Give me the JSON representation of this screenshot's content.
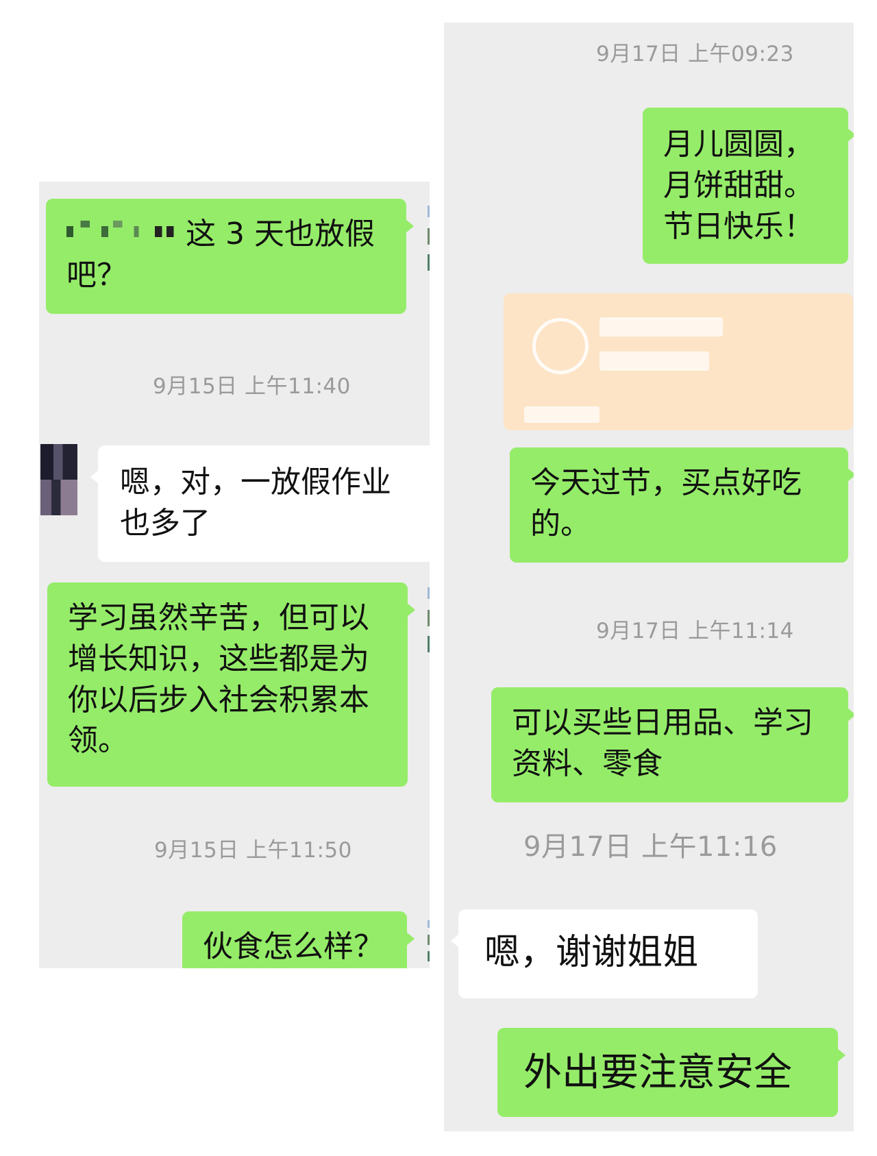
{
  "left": {
    "msg1_text": "这 3 天也放假吧？",
    "ts1": "9月15日 上午11:40",
    "msg2_text": "嗯，对，一放假作业也多了",
    "msg3_text": "学习虽然辛苦，但可以增长知识，这些都是为你以后步入社会积累本领。",
    "ts2": "9月15日 上午11:50",
    "msg4_text": "伙食怎么样？"
  },
  "right": {
    "ts1": "9月17日 上午09:23",
    "msg1_text": "月儿圆圆，月饼甜甜。节日快乐！",
    "msg2_text": "今天过节，买点好吃的。",
    "ts2": "9月17日 上午11:14",
    "msg3_text": "可以买些日用品、学习资料、零食",
    "ts3": "9月17日 上午11:16",
    "msg4_text": "嗯，谢谢姐姐",
    "msg5_text": "外出要注意安全"
  },
  "colors": {
    "outgoing_bubble": "#95ec69",
    "incoming_bubble": "#ffffff",
    "chat_background": "#ededed",
    "timestamp_text": "#9a9a9a",
    "red_packet": "#fde4c7"
  }
}
